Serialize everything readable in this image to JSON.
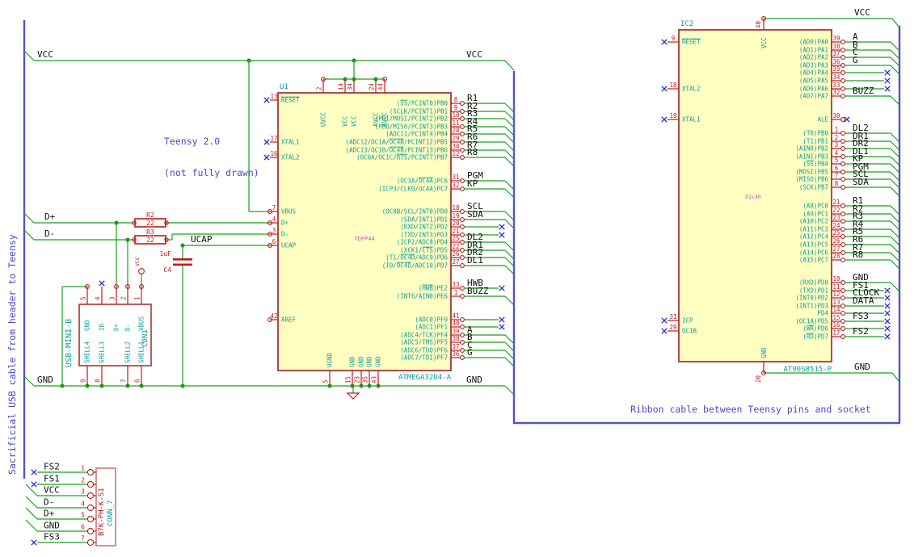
{
  "notes": {
    "teensy_line1": "Teensy 2.0",
    "teensy_line2": "(not fully drawn)",
    "ribbon": "Ribbon cable between Teensy pins and socket",
    "sacrificial": "Sacrificial USB cable from header to Teensy"
  },
  "net_labels": {
    "vcc": "VCC",
    "gnd": "GND",
    "ucap": "UCAP",
    "dp": "D+",
    "dm": "D-"
  },
  "power_flag": "VCC",
  "components": {
    "u1": {
      "ref": "U1",
      "value": "ATMEGA32U4-A",
      "footprint": "TQFP44",
      "top_pins": [
        {
          "name": "UVCC",
          "num": "2"
        },
        {
          "name": "VCC",
          "num": "14"
        },
        {
          "name": "VCC",
          "num": "34"
        },
        {
          "name": "AVCC",
          "num": "24"
        },
        {
          "name": "AVCC",
          "num": "44"
        }
      ],
      "left_pins": [
        {
          "name": "{RESET}",
          "num": "13",
          "conn": "nc"
        },
        {
          "name": "XTAL1",
          "num": "17",
          "conn": "nc"
        },
        {
          "name": "XTAL2",
          "num": "16",
          "conn": "nc"
        },
        {
          "name": "VBUS",
          "num": "7",
          "conn": "wire"
        },
        {
          "name": "D+",
          "num": "4",
          "conn": "wire"
        },
        {
          "name": "D-",
          "num": "3",
          "conn": "wire"
        },
        {
          "name": "UCAP",
          "num": "6",
          "conn": "wire"
        },
        {
          "name": "AREF",
          "num": "42",
          "conn": "stub"
        }
      ],
      "bottom_pins": [
        {
          "name": "UGND",
          "num": "5"
        },
        {
          "name": "GND",
          "num": "15"
        },
        {
          "name": "GND",
          "num": "23"
        },
        {
          "name": "GND",
          "num": "35"
        },
        {
          "name": "GND",
          "num": "43"
        }
      ],
      "right_pins": [
        {
          "name": "({SS}/PCINT0)PB0",
          "num": "8",
          "label": "R1",
          "conn": "bus"
        },
        {
          "name": "(SCLK/PCINT1)PB1",
          "num": "9",
          "label": "R2",
          "conn": "bus"
        },
        {
          "name": "(PDI/MOSI/PCINT2)PB2",
          "num": "10",
          "label": "R3",
          "conn": "bus"
        },
        {
          "name": "(PDO/MISO/PCINT3)PB3",
          "num": "11",
          "label": "R4",
          "conn": "bus"
        },
        {
          "name": "(ADC11/PCINT4)PB4",
          "num": "28",
          "label": "R5",
          "conn": "bus"
        },
        {
          "name": "(ADC12/OC1A/{OC4B}/PCINT12)PB5",
          "num": "29",
          "label": "R6",
          "conn": "bus"
        },
        {
          "name": "(ADC13/OC1B/{OC4B}/PCINT13)PB6",
          "num": "30",
          "label": "R7",
          "conn": "bus"
        },
        {
          "name": "(OC0A/OC1C/{RTS}/PCINT7)PB7",
          "num": "12",
          "label": "R8",
          "conn": "bus"
        },
        {
          "name": "(OC3A/{OC4A})PC6",
          "num": "31",
          "label": "PGM",
          "conn": "bus"
        },
        {
          "name": "(ICP3/CLK0/OC4A)PC7",
          "num": "32",
          "label": "KP",
          "conn": "bus"
        },
        {
          "name": "(OC0B/SCL/INT0)PD0",
          "num": "18",
          "label": "SCL",
          "conn": "bus"
        },
        {
          "name": "(SDA/INT1)PD1",
          "num": "19",
          "label": "SDA",
          "conn": "bus"
        },
        {
          "name": "(RXD/INT2)PD2",
          "num": "20",
          "label": "",
          "conn": "nc"
        },
        {
          "name": "(TXD/INT3)PD3",
          "num": "21",
          "label": "",
          "conn": "nc"
        },
        {
          "name": "(ICP2/ADC8)PD4",
          "num": "25",
          "label": "DL2",
          "conn": "bus"
        },
        {
          "name": "(XCK1/{CTS})PD5",
          "num": "22",
          "label": "DR1",
          "conn": "bus"
        },
        {
          "name": "(T1/{OC4D}/ADC9)PD6",
          "num": "26",
          "label": "DR2",
          "conn": "bus"
        },
        {
          "name": "(T0/{OC4D}/ADC10)PD7",
          "num": "27",
          "label": "DL1",
          "conn": "bus"
        },
        {
          "name": "({HWB})PE2",
          "num": "33",
          "label": "HWB",
          "conn": "nc"
        },
        {
          "name": "(INT6/AIN0)PE6",
          "num": "1",
          "label": "BUZZ",
          "conn": "bus"
        },
        {
          "name": "(ADC0)PF0",
          "num": "41",
          "label": "",
          "conn": "nc"
        },
        {
          "name": "(ADC1)PF1",
          "num": "40",
          "label": "",
          "conn": "nc"
        },
        {
          "name": "(ADC4/TCK)PF4",
          "num": "39",
          "label": "A",
          "conn": "bus"
        },
        {
          "name": "(ADC5/TMS)PF5",
          "num": "38",
          "label": "B",
          "conn": "bus"
        },
        {
          "name": "(ADC6/TDO)PF6",
          "num": "37",
          "label": "C",
          "conn": "bus"
        },
        {
          "name": "(ADC7/TDI)PF7",
          "num": "36",
          "label": "G",
          "conn": "bus"
        }
      ]
    },
    "ic2": {
      "ref": "IC2",
      "value": "AT90S8515-P",
      "footprint": "DIL40",
      "top_pin": {
        "name": "VCC",
        "num": "40"
      },
      "bottom_pin": {
        "name": "GND",
        "num": "20"
      },
      "left_pins": [
        {
          "name": "{RESET}",
          "num": "9",
          "conn": "nc"
        },
        {
          "name": "XTAL2",
          "num": "18",
          "conn": "nc"
        },
        {
          "name": "XTAL1",
          "num": "19",
          "conn": "nc"
        },
        {
          "name": "ICP",
          "num": "31",
          "conn": "nc"
        },
        {
          "name": "OC1B",
          "num": "29",
          "conn": "nc"
        }
      ],
      "right_pins": [
        {
          "name": "(AD0)PA0",
          "num": "39",
          "label": "A",
          "conn": "bus"
        },
        {
          "name": "(AD1)PA1",
          "num": "38",
          "label": "B",
          "conn": "bus"
        },
        {
          "name": "(AD2)PA2",
          "num": "37",
          "label": "C",
          "conn": "bus"
        },
        {
          "name": "(AD3)PA3",
          "num": "36",
          "label": "G",
          "conn": "bus"
        },
        {
          "name": "(AD4)PA4",
          "num": "35",
          "label": "",
          "conn": "nc"
        },
        {
          "name": "(AD5)PA5",
          "num": "34",
          "label": "",
          "conn": "nc"
        },
        {
          "name": "(AD6)PA6",
          "num": "33",
          "label": "",
          "conn": "nc"
        },
        {
          "name": "(AD7)PA7",
          "num": "32",
          "label": "BUZZ",
          "conn": "bus"
        },
        {
          "name": "ALE",
          "num": "30",
          "label": "",
          "conn": "ncshort"
        },
        {
          "name": "(T0)PB0",
          "num": "1",
          "label": "DL2",
          "conn": "bus"
        },
        {
          "name": "(T1)PB1",
          "num": "2",
          "label": "DR1",
          "conn": "bus"
        },
        {
          "name": "(AIN0)PB2",
          "num": "3",
          "label": "DR2",
          "conn": "bus"
        },
        {
          "name": "(AIN1)PB3",
          "num": "4",
          "label": "DL1",
          "conn": "bus"
        },
        {
          "name": "({SS})PB4",
          "num": "5",
          "label": "KP",
          "conn": "bus"
        },
        {
          "name": "(MOSI)PB5",
          "num": "6",
          "label": "PGM",
          "conn": "bus"
        },
        {
          "name": "(MISO)PB6",
          "num": "7",
          "label": "SCL",
          "conn": "bus"
        },
        {
          "name": "(SCK)PB7",
          "num": "8",
          "label": "SDA",
          "conn": "bus"
        },
        {
          "name": "(A8)PC0",
          "num": "21",
          "label": "R1",
          "conn": "bus"
        },
        {
          "name": "(A9)PC1",
          "num": "22",
          "label": "R2",
          "conn": "bus"
        },
        {
          "name": "(A10)PC2",
          "num": "23",
          "label": "R3",
          "conn": "bus"
        },
        {
          "name": "(A11)PC3",
          "num": "24",
          "label": "R4",
          "conn": "bus"
        },
        {
          "name": "(A12)PC4",
          "num": "25",
          "label": "R5",
          "conn": "bus"
        },
        {
          "name": "(A13)PC5",
          "num": "26",
          "label": "R6",
          "conn": "bus"
        },
        {
          "name": "(A14)PC6",
          "num": "27",
          "label": "R7",
          "conn": "bus"
        },
        {
          "name": "(A15)PC7",
          "num": "28",
          "label": "R8",
          "conn": "bus"
        },
        {
          "name": "(RXD)PD0",
          "num": "10",
          "label": "GND",
          "conn": "bus"
        },
        {
          "name": "(TXD)PD1",
          "num": "11",
          "label": "FS1",
          "conn": "nc"
        },
        {
          "name": "(INT0)PD2",
          "num": "12",
          "label": "CLOCK",
          "conn": "nc"
        },
        {
          "name": "(INT1)PD3",
          "num": "13",
          "label": "DATA",
          "conn": "nc"
        },
        {
          "name": "PD4",
          "num": "14",
          "label": "",
          "conn": "nc"
        },
        {
          "name": "(OC1A)PD5",
          "num": "15",
          "label": "FS3",
          "conn": "nc"
        },
        {
          "name": "({WR})PD6",
          "num": "16",
          "label": "",
          "conn": "nc"
        },
        {
          "name": "({RD})PD7",
          "num": "17",
          "label": "FS2",
          "conn": "nc"
        }
      ]
    },
    "con1": {
      "ref": "CON1",
      "value": "USB-MINI-B",
      "top_pins": [
        {
          "name": "GND",
          "num": "5",
          "conn": "wire"
        },
        {
          "name": "ID",
          "num": "4",
          "conn": "nc"
        },
        {
          "name": "D+",
          "num": "3",
          "conn": "wire"
        },
        {
          "name": "D-",
          "num": "2",
          "conn": "wire"
        },
        {
          "name": "VBUS",
          "num": "1",
          "conn": "pwr"
        }
      ],
      "bottom_pins": [
        {
          "name": "SHELL4",
          "num": "9"
        },
        {
          "name": "SHELL3",
          "num": "8"
        },
        {
          "name": "SHELL2",
          "num": "7"
        },
        {
          "name": "SHELL1",
          "num": "6"
        }
      ]
    },
    "conn7": {
      "ref": "CONN_7",
      "value": "B7K-PH-K-S1",
      "pins": [
        {
          "label": "FS2",
          "num": "1",
          "conn": "nc"
        },
        {
          "label": "FS1",
          "num": "2",
          "conn": "nc"
        },
        {
          "label": "VCC",
          "num": "3",
          "conn": "bus"
        },
        {
          "label": "D-",
          "num": "4",
          "conn": "bus"
        },
        {
          "label": "D+",
          "num": "5",
          "conn": "bus"
        },
        {
          "label": "GND",
          "num": "6",
          "conn": "bus"
        },
        {
          "label": "FS3",
          "num": "7",
          "conn": "nc"
        }
      ]
    },
    "r2": {
      "ref": "R2",
      "value": "22"
    },
    "r3": {
      "ref": "R3",
      "value": "22"
    },
    "c4": {
      "ref": "C4",
      "value": "1uF"
    }
  },
  "colors": {
    "wire": "#1BA11B",
    "bus": "#5353CB",
    "nc": "#2A2ACC",
    "body_fill": "#FFFFC2",
    "body_border": "#B04A4A",
    "pin": "#C01B1B",
    "pin_name": "#0F9B9B",
    "net_label": "#101010",
    "note": "#4A4AC8",
    "field": "#C455C4"
  }
}
